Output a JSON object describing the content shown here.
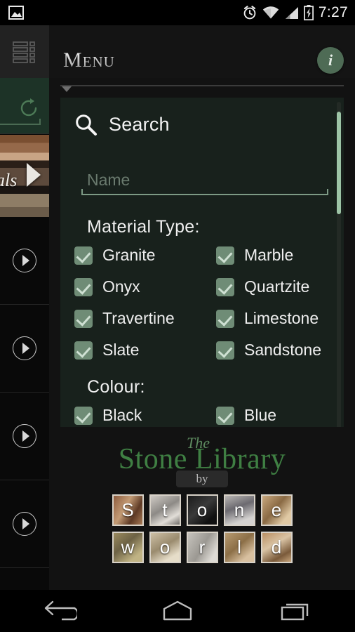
{
  "status_bar": {
    "time": "7:27",
    "icons": [
      "photo-icon",
      "alarm-icon",
      "wifi-icon",
      "signal-icon",
      "battery-charging-icon"
    ]
  },
  "app_bar": {
    "menu_icon": "list-menu-icon",
    "title": "Menu",
    "info_icon": "info-icon",
    "info_letter": "i"
  },
  "background_column": {
    "refresh_icon": "refresh-icon",
    "banner_text": "als",
    "banner_chevron": "chevron-right-icon",
    "row_arrow_icon": "circle-chevron-right-icon",
    "row_count": 4
  },
  "search_panel": {
    "search_icon": "search-icon",
    "heading": "Search",
    "name_input": {
      "value": "",
      "placeholder": "Name"
    },
    "material_type": {
      "title": "Material Type:",
      "options": [
        {
          "label": "Granite",
          "checked": true
        },
        {
          "label": "Marble",
          "checked": true
        },
        {
          "label": "Onyx",
          "checked": true
        },
        {
          "label": "Quartzite",
          "checked": true
        },
        {
          "label": "Travertine",
          "checked": true
        },
        {
          "label": "Limestone",
          "checked": true
        },
        {
          "label": "Slate",
          "checked": true
        },
        {
          "label": "Sandstone",
          "checked": true
        }
      ]
    },
    "colour": {
      "title": "Colour:",
      "options": [
        {
          "label": "Black",
          "checked": true
        },
        {
          "label": "Blue",
          "checked": true
        }
      ]
    },
    "scrollbar": {
      "name": "vertical-scrollbar"
    }
  },
  "branding": {
    "the": "The",
    "name": "Stone Library",
    "by": "by",
    "tiles_row1": [
      "S",
      "t",
      "o",
      "n",
      "e"
    ],
    "tiles_row2": [
      "w",
      "o",
      "r",
      "l",
      "d"
    ]
  },
  "nav_bar": {
    "back": "back-icon",
    "home": "home-icon",
    "recents": "recents-icon"
  },
  "colors": {
    "panel_bg": "#18211c",
    "accent_green": "#6f8c76",
    "scrollbar_thumb": "#9dc4a6",
    "brand_green": "#3f7f43",
    "underline": "#7d9a85"
  }
}
